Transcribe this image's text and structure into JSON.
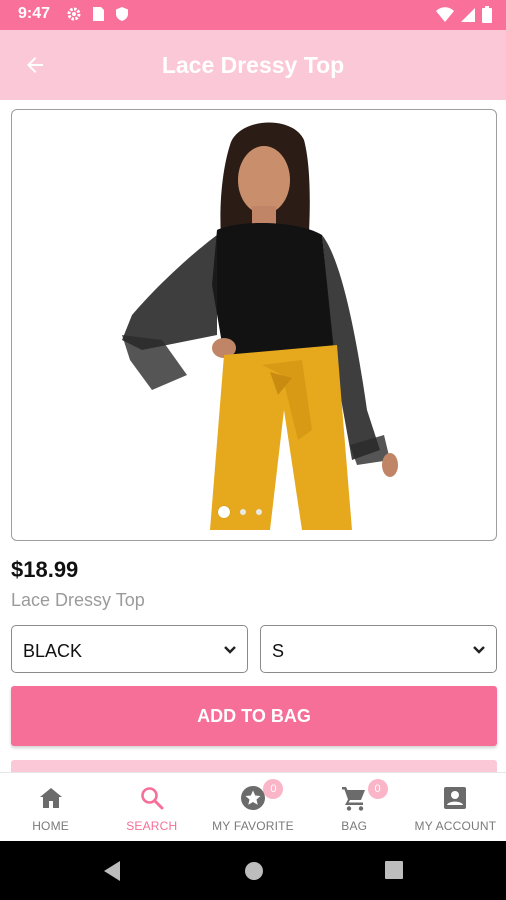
{
  "status_bar": {
    "time": "9:47",
    "left_icons": [
      "settings-icon",
      "sim-card-icon",
      "shield-icon"
    ],
    "right_icons": [
      "wifi-icon",
      "signal-icon",
      "battery-icon"
    ]
  },
  "app_bar": {
    "title": "Lace Dressy Top",
    "back_icon": "arrow-left-icon"
  },
  "product": {
    "image_alt": "Model wearing black lace top with yellow pants",
    "carousel": {
      "count": 3,
      "active_index": 0
    },
    "price": "$18.99",
    "name": "Lace Dressy Top",
    "color_select": {
      "value": "BLACK"
    },
    "size_select": {
      "value": "S"
    },
    "add_to_bag_label": "ADD TO BAG"
  },
  "bottom_nav": {
    "items": [
      {
        "label": "HOME",
        "icon": "home-icon",
        "active": false
      },
      {
        "label": "SEARCH",
        "icon": "search-icon",
        "active": true
      },
      {
        "label": "MY FAVORITE",
        "icon": "star-icon",
        "active": false,
        "badge": "0"
      },
      {
        "label": "BAG",
        "icon": "cart-icon",
        "active": false,
        "badge": "0"
      },
      {
        "label": "MY ACCOUNT",
        "icon": "account-icon",
        "active": false
      }
    ]
  },
  "colors": {
    "status_bar": "#f9709a",
    "app_bar": "#fbc8d8",
    "accent": "#f66f99",
    "badge": "#fbb5c8"
  }
}
